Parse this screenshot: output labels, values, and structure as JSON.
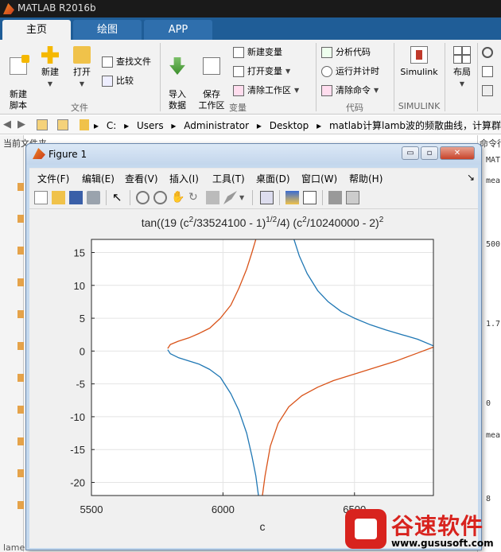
{
  "app": {
    "title": "MATLAB R2016b"
  },
  "tabs": [
    {
      "label": "主页",
      "active": true
    },
    {
      "label": "绘图",
      "active": false
    },
    {
      "label": "APP",
      "active": false
    }
  ],
  "ribbon": {
    "file_group": {
      "label": "文件",
      "new_script": "新建\n脚本",
      "new": "新建",
      "open": "打开",
      "find_files": "查找文件",
      "compare": "比较"
    },
    "variable_group": {
      "label": "变量",
      "import_data": "导入\n数据",
      "save_workspace": "保存\n工作区",
      "new_variable": "新建变量",
      "open_variable": "打开变量",
      "clear_workspace": "清除工作区"
    },
    "code_group": {
      "label": "代码",
      "analyze_code": "分析代码",
      "run_and_time": "运行并计时",
      "clear_commands": "清除命令"
    },
    "simulink_group": {
      "label": "SIMULINK",
      "simulink": "Simulink"
    },
    "environment_group": {
      "layout": "布局"
    }
  },
  "address": {
    "crumbs": [
      "C:",
      "Users",
      "Administrator",
      "Desktop",
      "matlab计算lamb波的频散曲线，计算群速度"
    ]
  },
  "panes": {
    "current_folder": "当前文件夹",
    "command_window": "命令行窗口",
    "right_fragments": [
      "MATL",
      "mea",
      "500",
      "1.7",
      "0",
      "mea",
      "8"
    ],
    "bottom_left": "lame"
  },
  "figure": {
    "title": "Figure 1",
    "menu": [
      "文件(F)",
      "编辑(E)",
      "查看(V)",
      "插入(I)",
      "工具(T)",
      "桌面(D)",
      "窗口(W)",
      "帮助(H)"
    ],
    "menu_arrow": "↘",
    "window_buttons": {
      "minimize": "▭",
      "restore": "▫",
      "close": "✕"
    }
  },
  "chart_data": {
    "type": "line",
    "title": "tan((19 (c^2/33524100 - 1)^(1/2)/4) (c^2/10240000 - 2)^2",
    "xlabel": "c",
    "ylabel": "",
    "xlim": [
      5500,
      6800
    ],
    "ylim": [
      -22,
      17
    ],
    "xticks": [
      5500,
      6000,
      6500
    ],
    "yticks": [
      -20,
      -15,
      -10,
      -5,
      0,
      5,
      10,
      15
    ],
    "grid": true,
    "series": [
      {
        "color": "#1f77b4",
        "segments": [
          {
            "x": [
              5790,
              5800,
              5830,
              5870,
              5910,
              5950,
              5990,
              6030,
              6060,
              6090,
              6110,
              6125,
              6135
            ],
            "y": [
              0.2,
              -0.4,
              -1.0,
              -1.5,
              -2.0,
              -2.8,
              -4.0,
              -6.5,
              -9.0,
              -12.5,
              -16.0,
              -19.0,
              -22.0
            ]
          },
          {
            "x": [
              6270,
              6290,
              6320,
              6360,
              6400,
              6450,
              6500,
              6560,
              6620,
              6680,
              6740,
              6800
            ],
            "y": [
              17.0,
              14.5,
              11.8,
              9.2,
              7.5,
              6.0,
              5.0,
              4.0,
              3.2,
              2.5,
              1.8,
              0.8
            ]
          }
        ]
      },
      {
        "color": "#d95319",
        "segments": [
          {
            "x": [
              5790,
              5800,
              5830,
              5870,
              5910,
              5950,
              5990,
              6030,
              6060,
              6090,
              6110,
              6125
            ],
            "y": [
              0.4,
              1.0,
              1.5,
              2.0,
              2.7,
              3.5,
              5.0,
              7.0,
              9.5,
              12.5,
              15.0,
              17.0
            ]
          },
          {
            "x": [
              6150,
              6160,
              6180,
              6210,
              6250,
              6300,
              6360,
              6420,
              6500,
              6580,
              6660,
              6740,
              6800
            ],
            "y": [
              -22.0,
              -19.0,
              -14.5,
              -11.0,
              -8.5,
              -6.8,
              -5.5,
              -4.5,
              -3.5,
              -2.5,
              -1.5,
              -0.3,
              0.6
            ]
          }
        ]
      }
    ]
  },
  "watermark": {
    "brand": "谷速软件",
    "url": "www.gususoft.com"
  }
}
